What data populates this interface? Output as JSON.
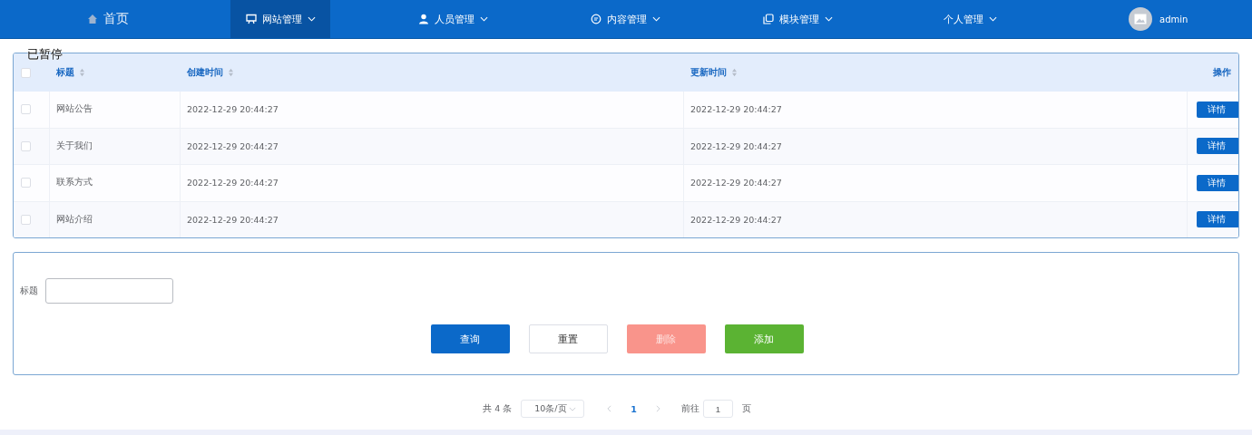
{
  "nav": {
    "items": [
      {
        "label": "首页",
        "selected": false,
        "dropdown": false
      },
      {
        "label": "网站管理",
        "selected": true,
        "dropdown": true
      },
      {
        "label": "人员管理",
        "selected": false,
        "dropdown": true
      },
      {
        "label": "内容管理",
        "selected": false,
        "dropdown": true
      },
      {
        "label": "模块管理",
        "selected": false,
        "dropdown": true
      },
      {
        "label": "个人管理",
        "selected": false,
        "dropdown": true
      }
    ],
    "user": {
      "name": "admin"
    }
  },
  "overlay_text": "已暂停",
  "table": {
    "columns": [
      {
        "label": "标题",
        "sortable": true
      },
      {
        "label": "创建时间",
        "sortable": true
      },
      {
        "label": "更新时间",
        "sortable": true
      },
      {
        "label": "操作",
        "sortable": false
      }
    ],
    "header_checked": false,
    "rows": [
      {
        "checked": false,
        "title": "网站公告",
        "created": "2022-12-29 20:44:27",
        "updated": "2022-12-29 20:44:27",
        "action": "详情"
      },
      {
        "checked": false,
        "title": "关于我们",
        "created": "2022-12-29 20:44:27",
        "updated": "2022-12-29 20:44:27",
        "action": "详情"
      },
      {
        "checked": false,
        "title": "联系方式",
        "created": "2022-12-29 20:44:27",
        "updated": "2022-12-29 20:44:27",
        "action": "详情"
      },
      {
        "checked": false,
        "title": "网站介绍",
        "created": "2022-12-29 20:44:27",
        "updated": "2022-12-29 20:44:27",
        "action": "详情"
      }
    ]
  },
  "search": {
    "label": "标题"
  },
  "buttons": [
    {
      "label": "查询",
      "kind": "primary"
    },
    {
      "label": "重置",
      "kind": "default"
    },
    {
      "label": "删除",
      "kind": "danger"
    },
    {
      "label": "添加",
      "kind": "success"
    }
  ],
  "pagination": {
    "total": "共 4 条",
    "page_size": "10条/页",
    "pages": [
      {
        "label": "1",
        "selected": true
      }
    ],
    "goto_label": "前往",
    "goto_value": "1",
    "goto_suffix": "页"
  }
}
